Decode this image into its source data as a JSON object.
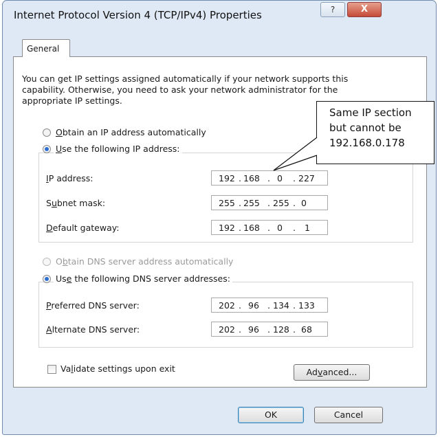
{
  "window": {
    "title": "Internet Protocol Version 4 (TCP/IPv4) Properties",
    "help_label": "?",
    "close_label": "X"
  },
  "tabs": [
    {
      "label": "General",
      "selected": true
    }
  ],
  "intro_text": "You can get IP settings assigned automatically if your network supports this capability. Otherwise, you need to ask your network administrator for the appropriate IP settings.",
  "ip_section": {
    "auto_radio": {
      "label_pre": "",
      "label_key": "O",
      "label_post": "btain an IP address automatically",
      "checked": false
    },
    "manual_radio": {
      "label_pre": "",
      "label_key": "U",
      "label_post": "se the following IP address:",
      "checked": true
    },
    "fields": [
      {
        "label_pre": "",
        "label_key": "I",
        "label_post": "P address:",
        "octets": [
          "192",
          "168",
          "0",
          "227"
        ]
      },
      {
        "label_pre": "S",
        "label_key": "u",
        "label_post": "bnet mask:",
        "octets": [
          "255",
          "255",
          "255",
          "0"
        ]
      },
      {
        "label_pre": "",
        "label_key": "D",
        "label_post": "efault gateway:",
        "octets": [
          "192",
          "168",
          "0",
          "1"
        ]
      }
    ]
  },
  "dns_section": {
    "auto_radio": {
      "label_pre": "O",
      "label_key": "b",
      "label_post": "tain DNS server address automatically",
      "checked": false,
      "disabled": true
    },
    "manual_radio": {
      "label_pre": "Us",
      "label_key": "e",
      "label_post": " the following DNS server addresses:",
      "checked": true
    },
    "fields": [
      {
        "label_pre": "",
        "label_key": "P",
        "label_post": "referred DNS server:",
        "octets": [
          "202",
          "96",
          "134",
          "133"
        ]
      },
      {
        "label_pre": "",
        "label_key": "A",
        "label_post": "lternate DNS server:",
        "octets": [
          "202",
          "96",
          "128",
          "68"
        ]
      }
    ]
  },
  "validate_checkbox": {
    "label_pre": "Va",
    "label_key": "l",
    "label_post": "idate settings upon exit",
    "checked": false
  },
  "buttons": {
    "advanced": {
      "pre": "Ad",
      "key": "v",
      "post": "anced..."
    },
    "ok": "OK",
    "cancel": "Cancel"
  },
  "callout": {
    "lines": [
      "Same IP section",
      "but cannot be",
      "192.168.0.178"
    ]
  }
}
